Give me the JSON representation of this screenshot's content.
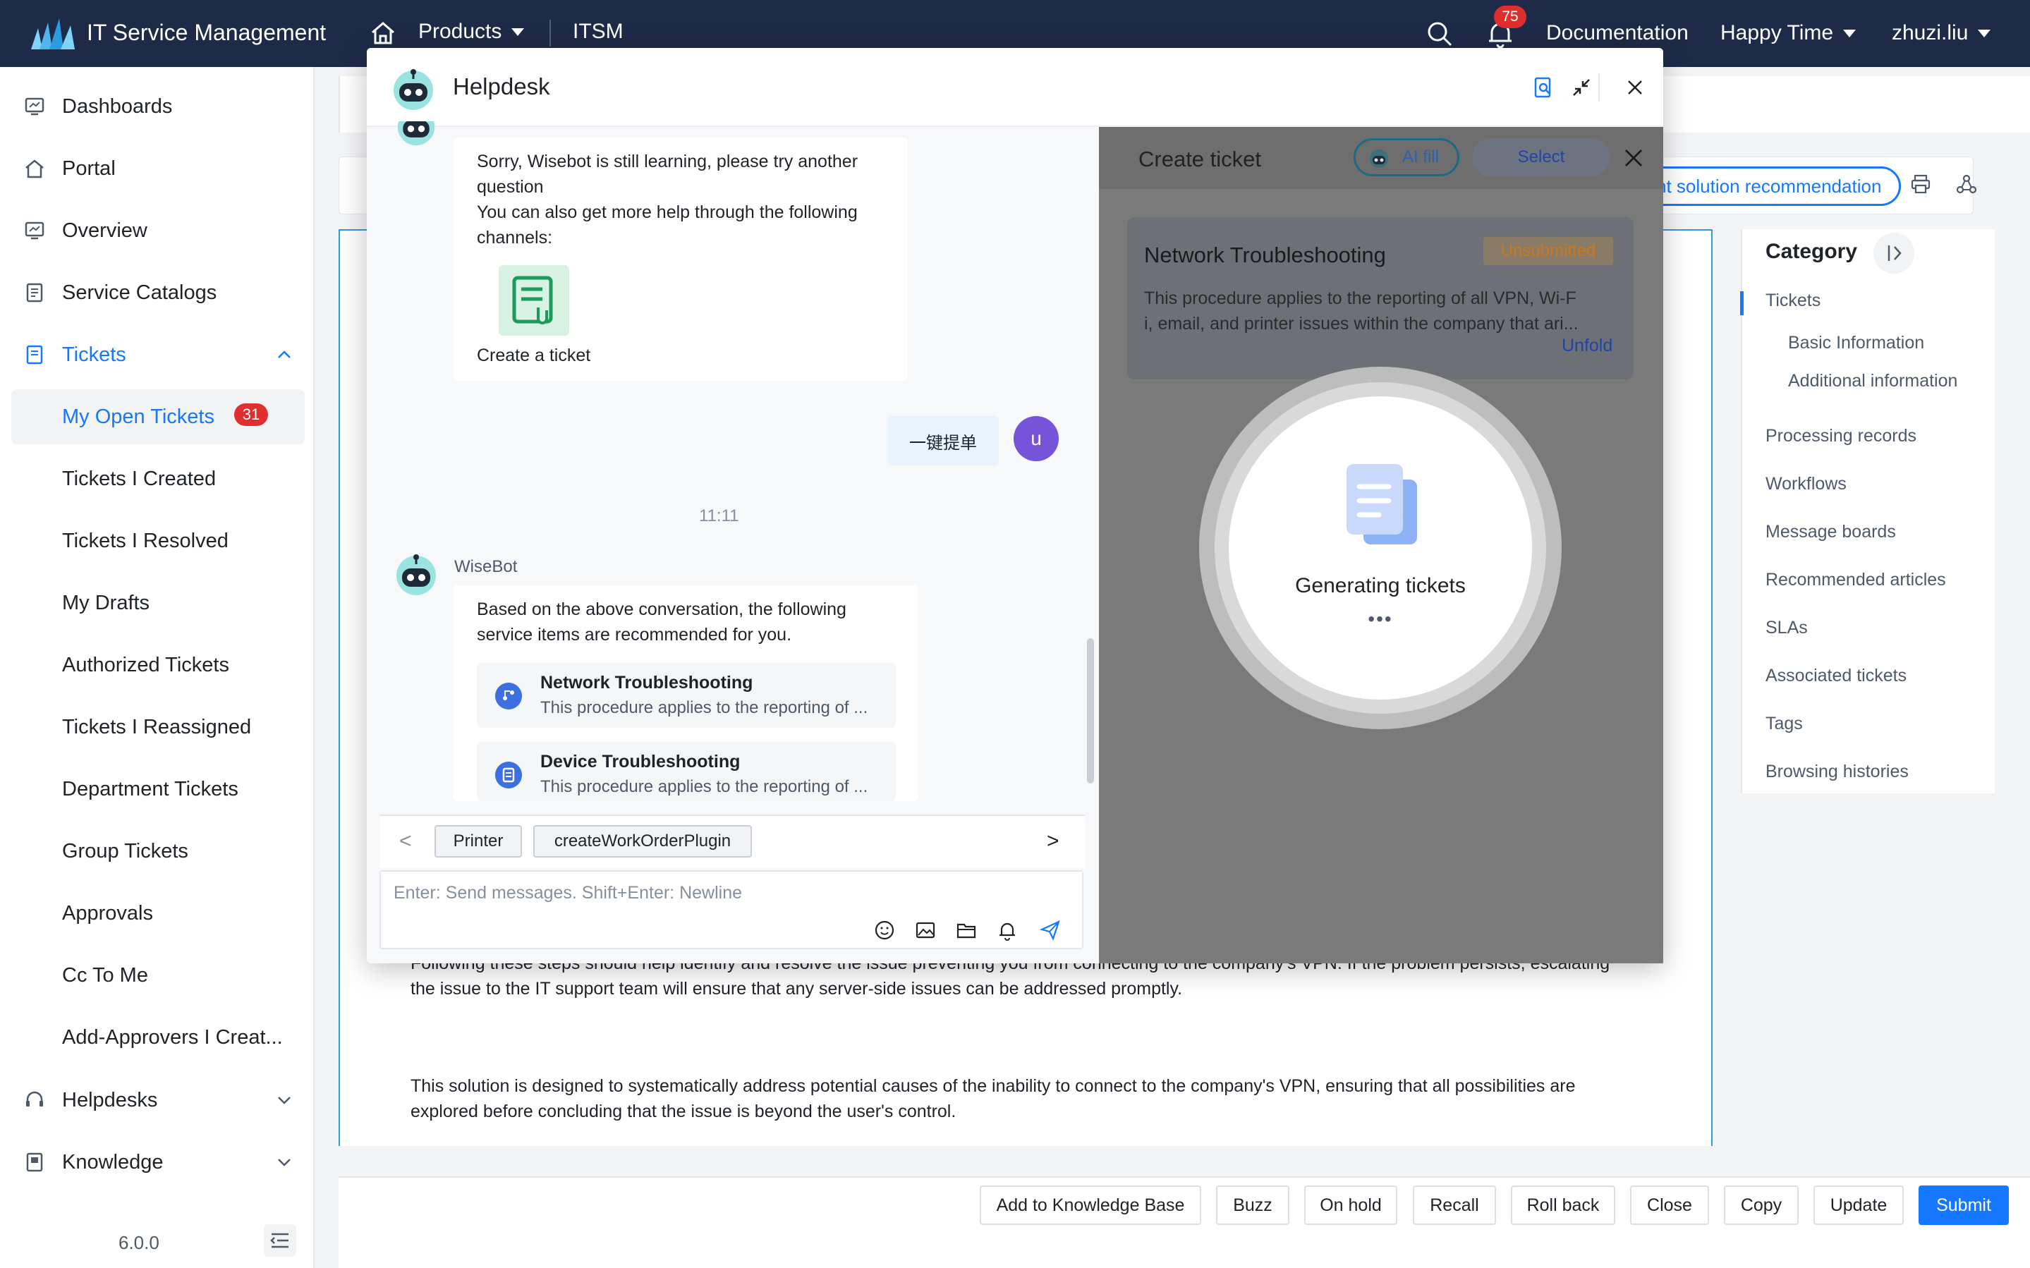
{
  "topbar": {
    "app_title": "IT Service Management",
    "products_label": "Products",
    "itsm_label": "ITSM",
    "notification_count": "75",
    "documentation_label": "Documentation",
    "workspace_label": "Happy Time",
    "user_label": "zhuzi.liu"
  },
  "sidebar": {
    "items": [
      {
        "label": "Dashboards",
        "icon": "dashboard-icon"
      },
      {
        "label": "Portal",
        "icon": "home-icon"
      },
      {
        "label": "Overview",
        "icon": "overview-icon"
      },
      {
        "label": "Service Catalogs",
        "icon": "catalog-icon"
      },
      {
        "label": "Tickets",
        "icon": "ticket-icon"
      }
    ],
    "ticket_subitems": [
      {
        "label": "My Open Tickets",
        "badge": "31"
      },
      {
        "label": "Tickets I Created"
      },
      {
        "label": "Tickets I Resolved"
      },
      {
        "label": "My Drafts"
      },
      {
        "label": "Authorized Tickets"
      },
      {
        "label": "Tickets I Reassigned"
      },
      {
        "label": "Department Tickets"
      },
      {
        "label": "Group Tickets"
      },
      {
        "label": "Approvals"
      },
      {
        "label": "Cc To Me"
      },
      {
        "label": "Add-Approvers I Creat..."
      }
    ],
    "bottom_items": [
      {
        "label": "Helpdesks",
        "icon": "helpdesk-icon"
      },
      {
        "label": "Knowledge",
        "icon": "knowledge-icon"
      }
    ],
    "version": "6.0.0"
  },
  "main": {
    "recommendation_pill": "nt solution recommendation",
    "paragraph1_line1": "Following these steps should help identify and resolve the issue preventing you from connecting to the company's VPN. If the problem persists, escalating",
    "paragraph1_line2": "the issue to the IT support team will ensure that any server-side issues can be addressed promptly.",
    "paragraph2_line1": "This solution is designed to systematically address potential causes of the inability to connect to the company's VPN, ensuring that all possibilities are",
    "paragraph2_line2": "explored before concluding that the issue is beyond the user's control."
  },
  "category": {
    "title": "Category",
    "items": [
      {
        "label": "Tickets"
      },
      {
        "label": "Basic Information"
      },
      {
        "label": "Additional information"
      },
      {
        "label": "Processing records"
      },
      {
        "label": "Workflows"
      },
      {
        "label": "Message boards"
      },
      {
        "label": "Recommended articles"
      },
      {
        "label": "SLAs"
      },
      {
        "label": "Associated tickets"
      },
      {
        "label": "Tags"
      },
      {
        "label": "Browsing histories"
      }
    ]
  },
  "actions": [
    {
      "label": "Add to Knowledge Base"
    },
    {
      "label": "Buzz"
    },
    {
      "label": "On hold"
    },
    {
      "label": "Recall"
    },
    {
      "label": "Roll back"
    },
    {
      "label": "Close"
    },
    {
      "label": "Copy"
    },
    {
      "label": "Update"
    },
    {
      "label": "Submit"
    }
  ],
  "helpdesk": {
    "title": "Helpdesk",
    "bot_msg_line1": "Sorry, Wisebot is still learning, please try another",
    "bot_msg_line2": "question",
    "bot_msg_line3": "You can also get more help through the following",
    "bot_msg_line4": "channels:",
    "create_ticket_label": "Create a ticket",
    "user_message": "一键提单",
    "user_initial": "u",
    "time": "11:11",
    "bot_name": "WiseBot",
    "recommend_line1": "Based on the above conversation, the following",
    "recommend_line2": "service items are recommended for you.",
    "services": [
      {
        "title": "Network Troubleshooting",
        "desc": "This procedure applies to the reporting of ..."
      },
      {
        "title": "Device Troubleshooting",
        "desc": "This procedure applies to the reporting of ..."
      }
    ],
    "chips": [
      "Printer",
      "createWorkOrderPlugin"
    ],
    "input_placeholder": "Enter: Send messages. Shift+Enter: Newline"
  },
  "create_ticket": {
    "title": "Create ticket",
    "ai_fill_label": "AI fill",
    "select_label": "Select",
    "card_title": "Network Troubleshooting",
    "status": "Unsubmitted",
    "desc_line1": "This procedure applies to the reporting of all VPN, Wi-F",
    "desc_line2": "i, email, and printer issues within the company that ari...",
    "unfold_label": "Unfold",
    "generating_label": "Generating tickets",
    "dots": "•••"
  }
}
